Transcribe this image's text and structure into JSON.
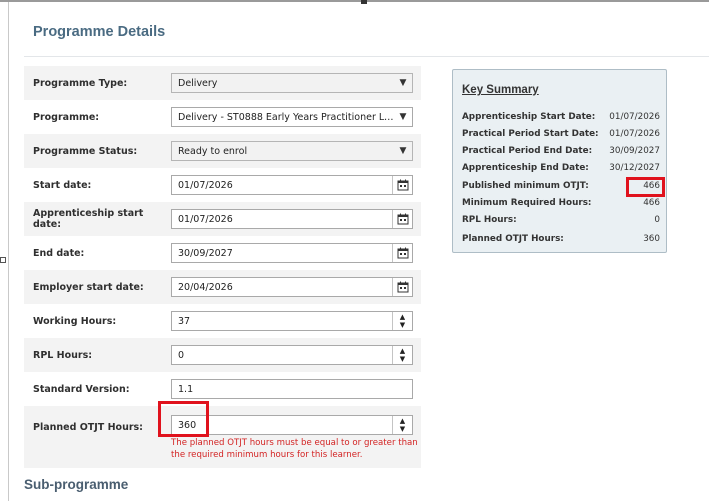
{
  "page": {
    "title": "Programme Details",
    "sub_title": "Sub-programme"
  },
  "form": {
    "programme_type": {
      "label": "Programme Type:",
      "value": "Delivery"
    },
    "programme": {
      "label": "Programme:",
      "value": "Delivery - ST0888 Early Years Practitioner Level 2 ..."
    },
    "programme_status": {
      "label": "Programme Status:",
      "value": "Ready to enrol"
    },
    "start_date": {
      "label": "Start date:",
      "value": "01/07/2026"
    },
    "apprenticeship_start_date": {
      "label": "Apprenticeship start date:",
      "value": "01/07/2026"
    },
    "end_date": {
      "label": "End date:",
      "value": "30/09/2027"
    },
    "employer_start_date": {
      "label": "Employer start date:",
      "value": "20/04/2026"
    },
    "working_hours": {
      "label": "Working Hours:",
      "value": "37"
    },
    "rpl_hours": {
      "label": "RPL Hours:",
      "value": "0"
    },
    "standard_version": {
      "label": "Standard Version:",
      "value": "1.1"
    },
    "planned_otjt_hours": {
      "label": "Planned OTJT Hours:",
      "value": "360",
      "error": "The planned OTJT hours must be equal to or greater than the required minimum hours for this learner."
    }
  },
  "summary": {
    "title": "Key Summary",
    "rows": [
      {
        "key": "Apprenticeship Start Date:",
        "value": "01/07/2026"
      },
      {
        "key": "Practical Period Start Date:",
        "value": "01/07/2026"
      },
      {
        "key": "Practical Period End Date:",
        "value": "30/09/2027"
      },
      {
        "key": "Apprenticeship End Date:",
        "value": "30/12/2027"
      },
      {
        "key": "Published minimum OTJT:",
        "value": "466"
      },
      {
        "key": "Minimum Required Hours:",
        "value": "466"
      },
      {
        "key": "RPL Hours:",
        "value": "0"
      },
      {
        "key": "Planned OTJT Hours:",
        "value": "360"
      }
    ]
  },
  "icons": {
    "select": "chevron-down-icon",
    "date": "calendar-icon",
    "number": "spinner-arrows-icon"
  },
  "colors": {
    "title": "#4a6b82",
    "error": "#d32424",
    "highlight": "#e0121d",
    "summary_bg": "#eaf0f3"
  }
}
